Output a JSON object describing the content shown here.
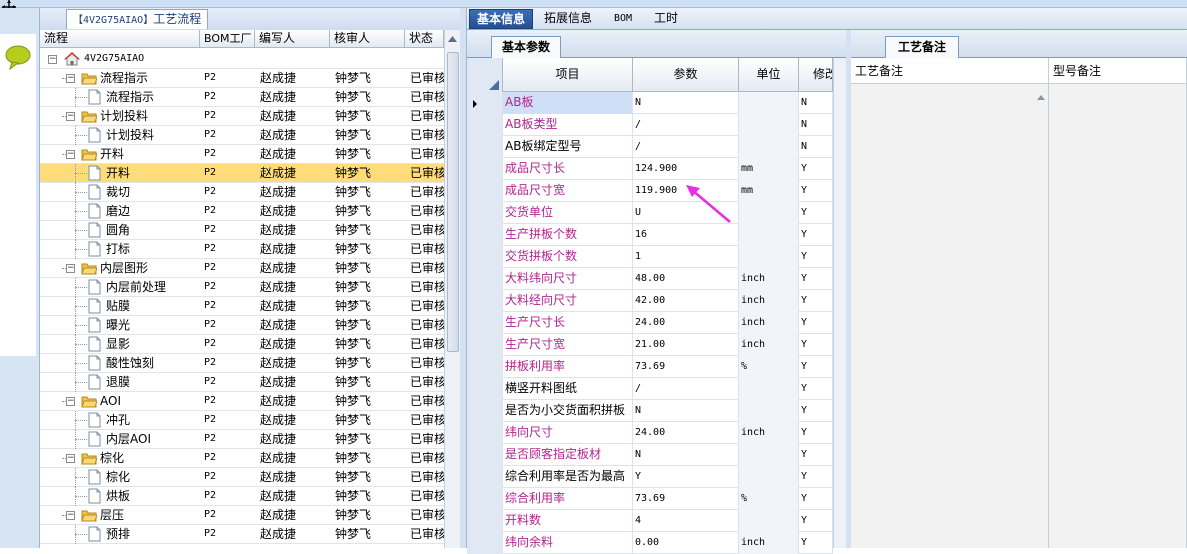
{
  "process_panel": {
    "title_prefix": "【4V2G75AIAO】",
    "title_suffix": "工艺流程",
    "columns": [
      "流程",
      "BOM工厂",
      "编写人",
      "核审人",
      "状态"
    ],
    "rows": [
      {
        "level": 0,
        "type": "root",
        "label": "4V2G75AIAO",
        "bom": "",
        "writer": "",
        "reviewer": "",
        "status": "",
        "expander": "−"
      },
      {
        "level": 1,
        "type": "folder",
        "label": "流程指示",
        "bom": "P2",
        "writer": "赵成捷",
        "reviewer": "钟梦飞",
        "status": "已审核",
        "expander": "−"
      },
      {
        "level": 2,
        "type": "doc",
        "label": "流程指示",
        "bom": "P2",
        "writer": "赵成捷",
        "reviewer": "钟梦飞",
        "status": "已审核"
      },
      {
        "level": 1,
        "type": "folder",
        "label": "计划投料",
        "bom": "P2",
        "writer": "赵成捷",
        "reviewer": "钟梦飞",
        "status": "已审核",
        "expander": "−"
      },
      {
        "level": 2,
        "type": "doc",
        "label": "计划投料",
        "bom": "P2",
        "writer": "赵成捷",
        "reviewer": "钟梦飞",
        "status": "已审核"
      },
      {
        "level": 1,
        "type": "folder",
        "label": "开料",
        "bom": "P2",
        "writer": "赵成捷",
        "reviewer": "钟梦飞",
        "status": "已审核",
        "expander": "−"
      },
      {
        "level": 2,
        "type": "doc",
        "label": "开料",
        "bom": "P2",
        "writer": "赵成捷",
        "reviewer": "钟梦飞",
        "status": "已审核",
        "selected": true
      },
      {
        "level": 2,
        "type": "doc",
        "label": "裁切",
        "bom": "P2",
        "writer": "赵成捷",
        "reviewer": "钟梦飞",
        "status": "已审核"
      },
      {
        "level": 2,
        "type": "doc",
        "label": "磨边",
        "bom": "P2",
        "writer": "赵成捷",
        "reviewer": "钟梦飞",
        "status": "已审核"
      },
      {
        "level": 2,
        "type": "doc",
        "label": "圆角",
        "bom": "P2",
        "writer": "赵成捷",
        "reviewer": "钟梦飞",
        "status": "已审核"
      },
      {
        "level": 2,
        "type": "doc",
        "label": "打标",
        "bom": "P2",
        "writer": "赵成捷",
        "reviewer": "钟梦飞",
        "status": "已审核"
      },
      {
        "level": 1,
        "type": "folder",
        "label": "内层图形",
        "bom": "P2",
        "writer": "赵成捷",
        "reviewer": "钟梦飞",
        "status": "已审核",
        "expander": "−"
      },
      {
        "level": 2,
        "type": "doc",
        "label": "内层前处理",
        "bom": "P2",
        "writer": "赵成捷",
        "reviewer": "钟梦飞",
        "status": "已审核"
      },
      {
        "level": 2,
        "type": "doc",
        "label": "贴膜",
        "bom": "P2",
        "writer": "赵成捷",
        "reviewer": "钟梦飞",
        "status": "已审核"
      },
      {
        "level": 2,
        "type": "doc",
        "label": "曝光",
        "bom": "P2",
        "writer": "赵成捷",
        "reviewer": "钟梦飞",
        "status": "已审核"
      },
      {
        "level": 2,
        "type": "doc",
        "label": "显影",
        "bom": "P2",
        "writer": "赵成捷",
        "reviewer": "钟梦飞",
        "status": "已审核"
      },
      {
        "level": 2,
        "type": "doc",
        "label": "酸性蚀刻",
        "bom": "P2",
        "writer": "赵成捷",
        "reviewer": "钟梦飞",
        "status": "已审核"
      },
      {
        "level": 2,
        "type": "doc",
        "label": "退膜",
        "bom": "P2",
        "writer": "赵成捷",
        "reviewer": "钟梦飞",
        "status": "已审核"
      },
      {
        "level": 1,
        "type": "folder",
        "label": "AOI",
        "bom": "P2",
        "writer": "赵成捷",
        "reviewer": "钟梦飞",
        "status": "已审核",
        "expander": "−"
      },
      {
        "level": 2,
        "type": "doc",
        "label": "冲孔",
        "bom": "P2",
        "writer": "赵成捷",
        "reviewer": "钟梦飞",
        "status": "已审核"
      },
      {
        "level": 2,
        "type": "doc",
        "label": "内层AOI",
        "bom": "P2",
        "writer": "赵成捷",
        "reviewer": "钟梦飞",
        "status": "已审核"
      },
      {
        "level": 1,
        "type": "folder",
        "label": "棕化",
        "bom": "P2",
        "writer": "赵成捷",
        "reviewer": "钟梦飞",
        "status": "已审核",
        "expander": "−"
      },
      {
        "level": 2,
        "type": "doc",
        "label": "棕化",
        "bom": "P2",
        "writer": "赵成捷",
        "reviewer": "钟梦飞",
        "status": "已审核"
      },
      {
        "level": 2,
        "type": "doc",
        "label": "烘板",
        "bom": "P2",
        "writer": "赵成捷",
        "reviewer": "钟梦飞",
        "status": "已审核"
      },
      {
        "level": 1,
        "type": "folder",
        "label": "层压",
        "bom": "P2",
        "writer": "赵成捷",
        "reviewer": "钟梦飞",
        "status": "已审核",
        "expander": "−"
      },
      {
        "level": 2,
        "type": "doc",
        "label": "预排",
        "bom": "P2",
        "writer": "赵成捷",
        "reviewer": "钟梦飞",
        "status": "已审核"
      }
    ]
  },
  "main_tabs": [
    {
      "label": "基本信息",
      "active": true
    },
    {
      "label": "拓展信息",
      "active": false
    },
    {
      "label": "BOM",
      "active": false
    },
    {
      "label": "工时",
      "active": false
    }
  ],
  "params_panel": {
    "subtab": "基本参数",
    "columns": [
      "项目",
      "参数",
      "单位",
      "修改"
    ],
    "rows": [
      {
        "item": "AB板",
        "param": "N",
        "unit": "",
        "mod": "N",
        "pink": true,
        "current": true,
        "highlight": true
      },
      {
        "item": "AB板类型",
        "param": "/",
        "unit": "",
        "mod": "N",
        "pink": true
      },
      {
        "item": "AB板绑定型号",
        "param": "/",
        "unit": "",
        "mod": "N",
        "pink": false
      },
      {
        "item": "成品尺寸长",
        "param": "124.900",
        "unit": "mm",
        "mod": "Y",
        "pink": true
      },
      {
        "item": "成品尺寸宽",
        "param": "119.900",
        "unit": "mm",
        "mod": "Y",
        "pink": true
      },
      {
        "item": "交货单位",
        "param": "U",
        "unit": "",
        "mod": "Y",
        "pink": true
      },
      {
        "item": "生产拼板个数",
        "param": "16",
        "unit": "",
        "mod": "Y",
        "pink": true
      },
      {
        "item": "交货拼板个数",
        "param": "1",
        "unit": "",
        "mod": "Y",
        "pink": true
      },
      {
        "item": "大料纬向尺寸",
        "param": "48.00",
        "unit": "inch",
        "mod": "Y",
        "pink": true
      },
      {
        "item": "大料经向尺寸",
        "param": "42.00",
        "unit": "inch",
        "mod": "Y",
        "pink": true
      },
      {
        "item": "生产尺寸长",
        "param": "24.00",
        "unit": "inch",
        "mod": "Y",
        "pink": true
      },
      {
        "item": "生产尺寸宽",
        "param": "21.00",
        "unit": "inch",
        "mod": "Y",
        "pink": true
      },
      {
        "item": "拼板利用率",
        "param": "73.69",
        "unit": "%",
        "mod": "Y",
        "pink": true
      },
      {
        "item": "横竖开料图纸",
        "param": "/",
        "unit": "",
        "mod": "Y",
        "pink": false
      },
      {
        "item": "是否为小交货面积拼板",
        "param": "N",
        "unit": "",
        "mod": "Y",
        "pink": false
      },
      {
        "item": "纬向尺寸",
        "param": "24.00",
        "unit": "inch",
        "mod": "Y",
        "pink": true
      },
      {
        "item": "是否顾客指定板材",
        "param": "N",
        "unit": "",
        "mod": "Y",
        "pink": true
      },
      {
        "item": "综合利用率是否为最高",
        "param": "Y",
        "unit": "",
        "mod": "Y",
        "pink": false
      },
      {
        "item": "综合利用率",
        "param": "73.69",
        "unit": "%",
        "mod": "Y",
        "pink": true
      },
      {
        "item": "开料数",
        "param": "4",
        "unit": "",
        "mod": "Y",
        "pink": true
      },
      {
        "item": "纬向余料",
        "param": "0.00",
        "unit": "inch",
        "mod": "Y",
        "pink": true
      }
    ]
  },
  "notes_panel": {
    "tab": "工艺备注",
    "columns": [
      "工艺备注",
      "型号备注"
    ]
  },
  "colors": {
    "accent": "#2a5597",
    "pink_label": "#b2258f",
    "selected_row": "#ffdc7a",
    "annotation_arrow": "#e62ee6"
  }
}
